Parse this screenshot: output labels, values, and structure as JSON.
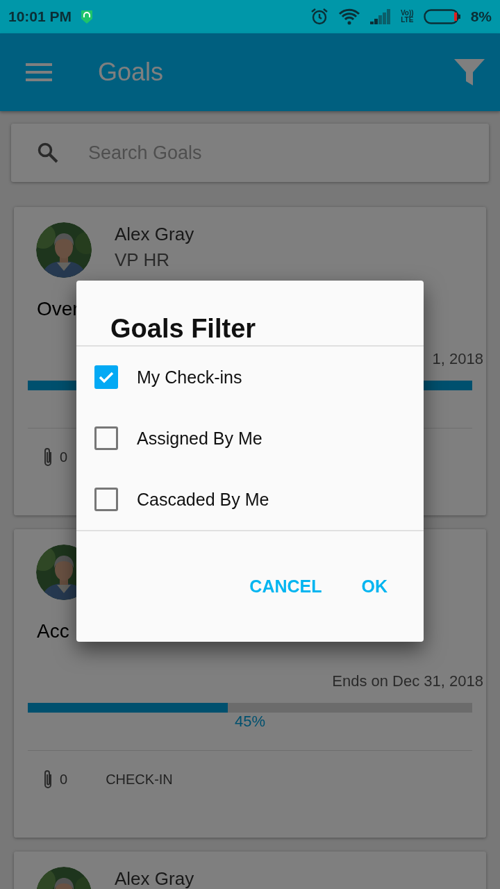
{
  "status_bar": {
    "time": "10:01 PM",
    "volte_top": "Vo))",
    "volte_bottom": "LTE",
    "battery": "8%"
  },
  "app_bar": {
    "title": "Goals"
  },
  "search": {
    "placeholder": "Search Goals"
  },
  "goals": [
    {
      "name": "Alex Gray",
      "role": "VP HR",
      "title": "Over",
      "ends": "1, 2018",
      "level": 1,
      "attachments": "0"
    },
    {
      "title": "Acc",
      "ends": "Ends on Dec 31, 2018",
      "level": 0.45,
      "percent": "45%",
      "attachments": "0",
      "action": "CHECK-IN"
    },
    {
      "name": "Alex Gray"
    }
  ],
  "dialog": {
    "title": "Goals Filter",
    "options": [
      {
        "label": "My Check-ins",
        "checked": true
      },
      {
        "label": "Assigned By Me",
        "checked": false
      },
      {
        "label": "Cascaded By Me",
        "checked": false
      }
    ],
    "buttons": [
      "CANCEL",
      "OK"
    ]
  }
}
